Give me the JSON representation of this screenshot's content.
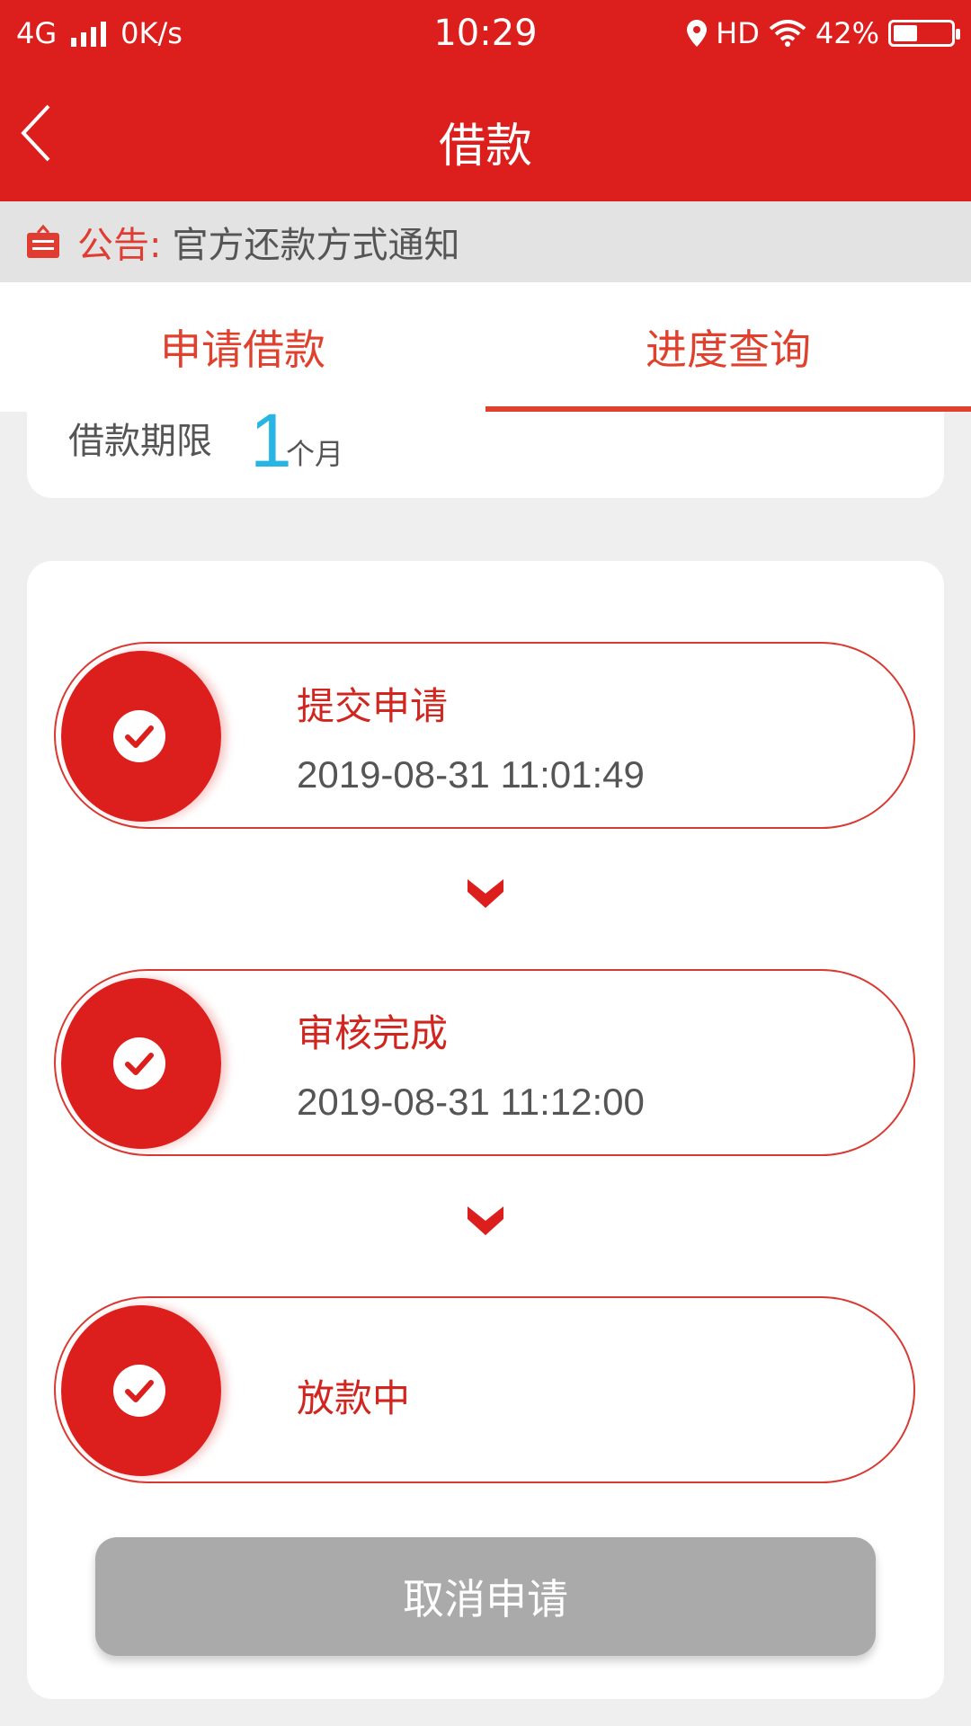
{
  "status_bar": {
    "network": "4G",
    "speed": "0K/s",
    "time": "10:29",
    "hd": "HD",
    "battery": "42%"
  },
  "nav": {
    "title": "借款"
  },
  "notice": {
    "label": "公告:",
    "text": "官方还款方式通知"
  },
  "tabs": [
    {
      "label": "申请借款",
      "active": false
    },
    {
      "label": "进度查询",
      "active": true
    }
  ],
  "term": {
    "label": "借款期限",
    "value": "1",
    "unit": "个月"
  },
  "steps": [
    {
      "title": "提交申请",
      "time": "2019-08-31 11:01:49"
    },
    {
      "title": "审核完成",
      "time": "2019-08-31 11:12:00"
    },
    {
      "title": "放款中",
      "time": ""
    }
  ],
  "cancel_label": "取消申请",
  "colors": {
    "brand_red": "#dc1f1d",
    "accent_blue": "#27b6e4",
    "button_gray": "#aaaaaa"
  }
}
